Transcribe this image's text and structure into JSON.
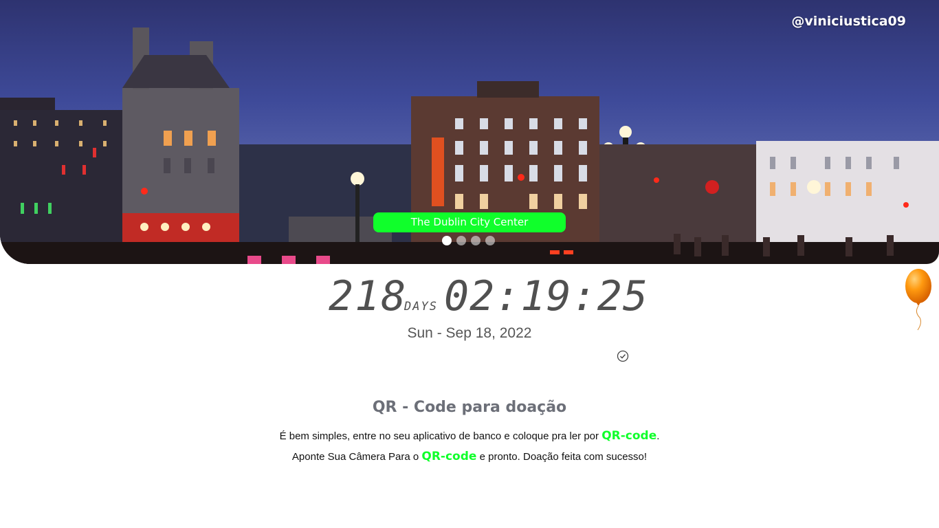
{
  "header": {
    "handle": "@viniciustica09"
  },
  "slider": {
    "caption": "The Dublin City Center",
    "dot_count": 4,
    "active_index": 0
  },
  "countdown": {
    "days": "218",
    "days_unit": "DAYS",
    "time": "02:19:25",
    "date": "Sun - Sep 18, 2022"
  },
  "donation": {
    "title": "QR - Code para doação",
    "line1_prefix": "É bem simples, entre no seu aplicativo de banco e coloque pra ler por ",
    "line1_highlight": "QR-code",
    "line1_suffix": ".",
    "line2_prefix": "Aponte Sua Câmera Para o ",
    "line2_highlight": "QR-code",
    "line2_suffix": " e pronto. Doação feita com sucesso!"
  },
  "colors": {
    "accent_green": "#10ff2b",
    "clock_gray": "#505050",
    "balloon_orange": "#ff8c00"
  }
}
